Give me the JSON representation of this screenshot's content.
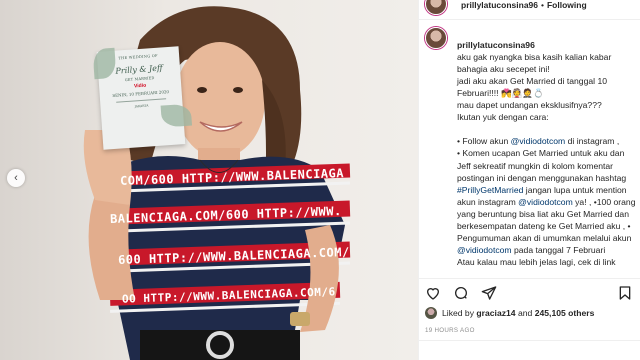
{
  "post": {
    "username": "prillylatuconsina96",
    "follow_label": "Following",
    "header_separator": "•",
    "caption_lines": [
      "aku gak nyangka bisa kasih kalian kabar bahagia aku secepet ini!",
      "jadi aku akan Get Married di tanggal 10 Februari!!!! 💏👰🤵💍",
      "mau dapet undangan eksklusifnya???",
      "Ikutan yuk dengan cara:"
    ],
    "bullets": [
      {
        "prefix": "• Follow akun ",
        "link": "@vidiodotcom",
        "suffix": " di instagram ,"
      },
      {
        "prefix": "• Komen ucapan Get Married untuk aku dan Jeff sekreatif mungkin di kolom komentar postingan ini dengan menggunakan hashtag ",
        "link": "#PrillyGetMarried",
        "suffix": " jangan lupa untuk mention akun instagram "
      },
      {
        "prefix": "",
        "link": "@vidiodotcom",
        "suffix": " ya! , •100 orang yang beruntung bisa liat aku Get Married dan berkesempatan dateng ke Get Married aku , • Pengumuman akan di umumkan melalui akun "
      },
      {
        "prefix": "",
        "link": "@vidiodotcom",
        "suffix": " pada tanggal 7 Februari"
      }
    ],
    "last_line": "Atau kalau mau lebih jelas lagi, cek di link",
    "liked_by_prefix": "Liked by ",
    "liked_by_user": "graciaz14",
    "liked_by_and": " and ",
    "likes_count": "245,105 others",
    "timestamp": "19 HOURS AGO"
  },
  "invitation_card": {
    "top": "THE WEDDING OF",
    "names": "Prilly & Jeff",
    "line1": "GET MARRIED",
    "brand": "Vidio",
    "date": "SENIN, 10 FEBRUARI 2020",
    "foot": "JAKARTA"
  },
  "shirt": {
    "line1": "COM/600 HTTP://WWW.BALENCIAGA",
    "line2": "BALENCIAGA.COM/600 HTTP://WWW.",
    "line3": "600 HTTP://WWW.BALENCIAGA.COM/",
    "line4": "OO HTTP://WWW.BALENCIAGA.COM/6"
  },
  "colors": {
    "link": "#00376b",
    "meta_gray": "#8e8e8e",
    "stripe_red": "#c8182a",
    "stripe_navy": "#1f2a4a"
  },
  "icons": [
    "heart-icon",
    "comment-icon",
    "share-icon",
    "bookmark-icon",
    "arrow-left-icon"
  ]
}
